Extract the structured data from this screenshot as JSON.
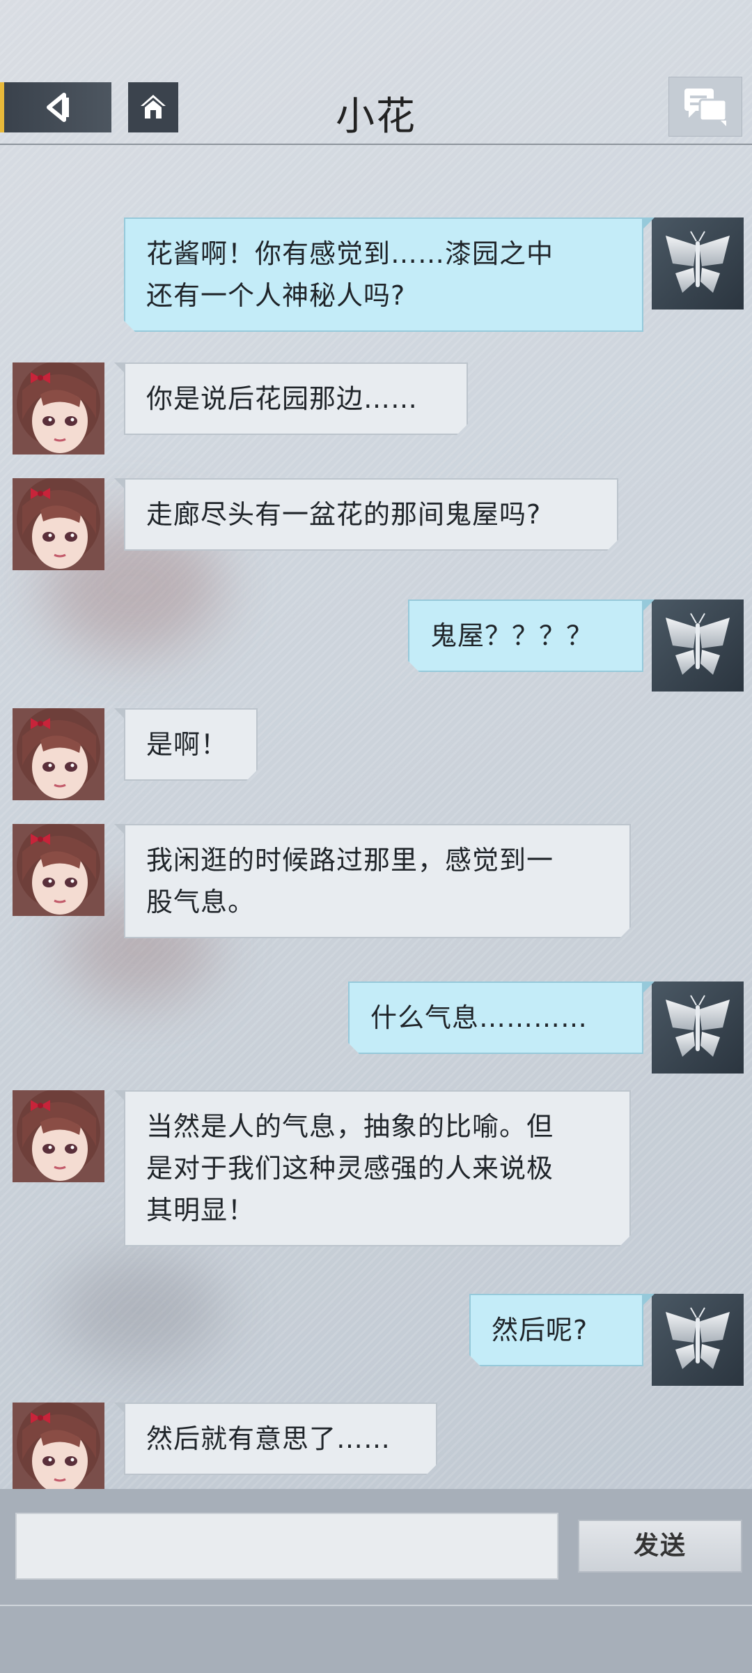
{
  "header": {
    "title": "小花",
    "back_icon": "back-arrow-icon",
    "home_icon": "home-icon",
    "chat_icon": "chat-bubbles-icon"
  },
  "contact": {
    "name": "小花",
    "avatar": "girl-avatar"
  },
  "me": {
    "avatar": "butterfly-avatar"
  },
  "messages": [
    {
      "from": "me",
      "lines": [
        "花酱啊！你有感觉到……漆园之中",
        "还有一个人神秘人吗?"
      ]
    },
    {
      "from": "contact",
      "lines": [
        "你是说后花园那边……"
      ]
    },
    {
      "from": "contact",
      "lines": [
        "走廊尽头有一盆花的那间鬼屋吗?"
      ]
    },
    {
      "from": "me",
      "lines": [
        "鬼屋？？？？"
      ]
    },
    {
      "from": "contact",
      "lines": [
        "是啊！"
      ]
    },
    {
      "from": "contact",
      "lines": [
        "我闲逛的时候路过那里，感觉到一",
        "股气息。"
      ]
    },
    {
      "from": "me",
      "lines": [
        "什么气息…………"
      ]
    },
    {
      "from": "contact",
      "lines": [
        "当然是人的气息，抽象的比喻。但",
        "是对于我们这种灵感强的人来说极",
        "其明显！"
      ]
    },
    {
      "from": "me",
      "lines": [
        "然后呢?"
      ]
    },
    {
      "from": "contact",
      "lines": [
        "然后就有意思了……"
      ]
    }
  ],
  "input": {
    "value": "",
    "placeholder": ""
  },
  "send_label": "发送",
  "colors": {
    "my_bubble": "#c4ecf8",
    "their_bubble": "#e8ecf0",
    "accent": "#e8b93a"
  }
}
